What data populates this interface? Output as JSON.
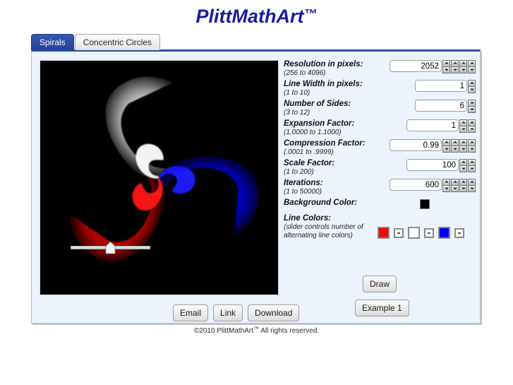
{
  "app": {
    "title": "PlittMathArt",
    "title_tm": "™",
    "background_color": "#ffffff",
    "panel_color": "#ecf3fd",
    "accent_color": "#2b4fa2",
    "title_color": "#1b1b9e"
  },
  "tabs": [
    {
      "label": "Spirals",
      "active": true
    },
    {
      "label": "Concentric Circles",
      "active": false
    }
  ],
  "artwork": {
    "name": "three-arm-logarithmic-spiral",
    "background": "#000000",
    "arm_colors": [
      "#ff0000",
      "#ffffff",
      "#0000ff"
    ],
    "arms": 3
  },
  "controls": [
    {
      "label": "Resolution in pixels:",
      "hint": "(256 to 4096)",
      "value": "2052",
      "spinners": 4,
      "name": "resolution"
    },
    {
      "label": "Line Width in pixels:",
      "hint": "(1 to 10)",
      "value": "1",
      "spinners": 1,
      "name": "line-width"
    },
    {
      "label": "Number of Sides:",
      "hint": "(3 to 12)",
      "value": "6",
      "spinners": 1,
      "name": "number-of-sides"
    },
    {
      "label": "Expansion Factor:",
      "hint": "(1.0000 to 1.1000)",
      "value": "1",
      "spinners": 2,
      "name": "expansion-factor"
    },
    {
      "label": "Compression Factor:",
      "hint": "(.0001 to .9999)",
      "value": "0.99",
      "spinners": 4,
      "name": "compression-factor"
    },
    {
      "label": "Scale Factor:",
      "hint": "(1 to 200)",
      "value": "100",
      "spinners": 2,
      "name": "scale-factor"
    },
    {
      "label": "Iterations:",
      "hint": "(1 to 50000)",
      "value": "600",
      "spinners": 4,
      "name": "iterations"
    }
  ],
  "background_color_control": {
    "label": "Background Color:",
    "value": "#000000"
  },
  "line_colors_control": {
    "label": "Line Colors:",
    "hint_line1": "(slider controls number of",
    "hint_line2": "alternating line colors)",
    "swatches": [
      {
        "color": "#ff0000",
        "enabled": true
      },
      {
        "color": "#ffffff",
        "enabled": false
      },
      {
        "color": "#ffffff",
        "enabled": true
      },
      {
        "color": "#ffffff",
        "enabled": false
      },
      {
        "color": "#0000ff",
        "enabled": true
      },
      {
        "color": "#ffffff",
        "enabled": false
      }
    ],
    "slider_value": 50
  },
  "buttons": {
    "email": "Email",
    "link": "Link",
    "download": "Download",
    "draw": "Draw",
    "example": "Example 1"
  },
  "footer": {
    "copyright_prefix": "©2010 PlittMathArt",
    "copyright_tm": "™",
    "copyright_suffix": " All rights reserved."
  }
}
